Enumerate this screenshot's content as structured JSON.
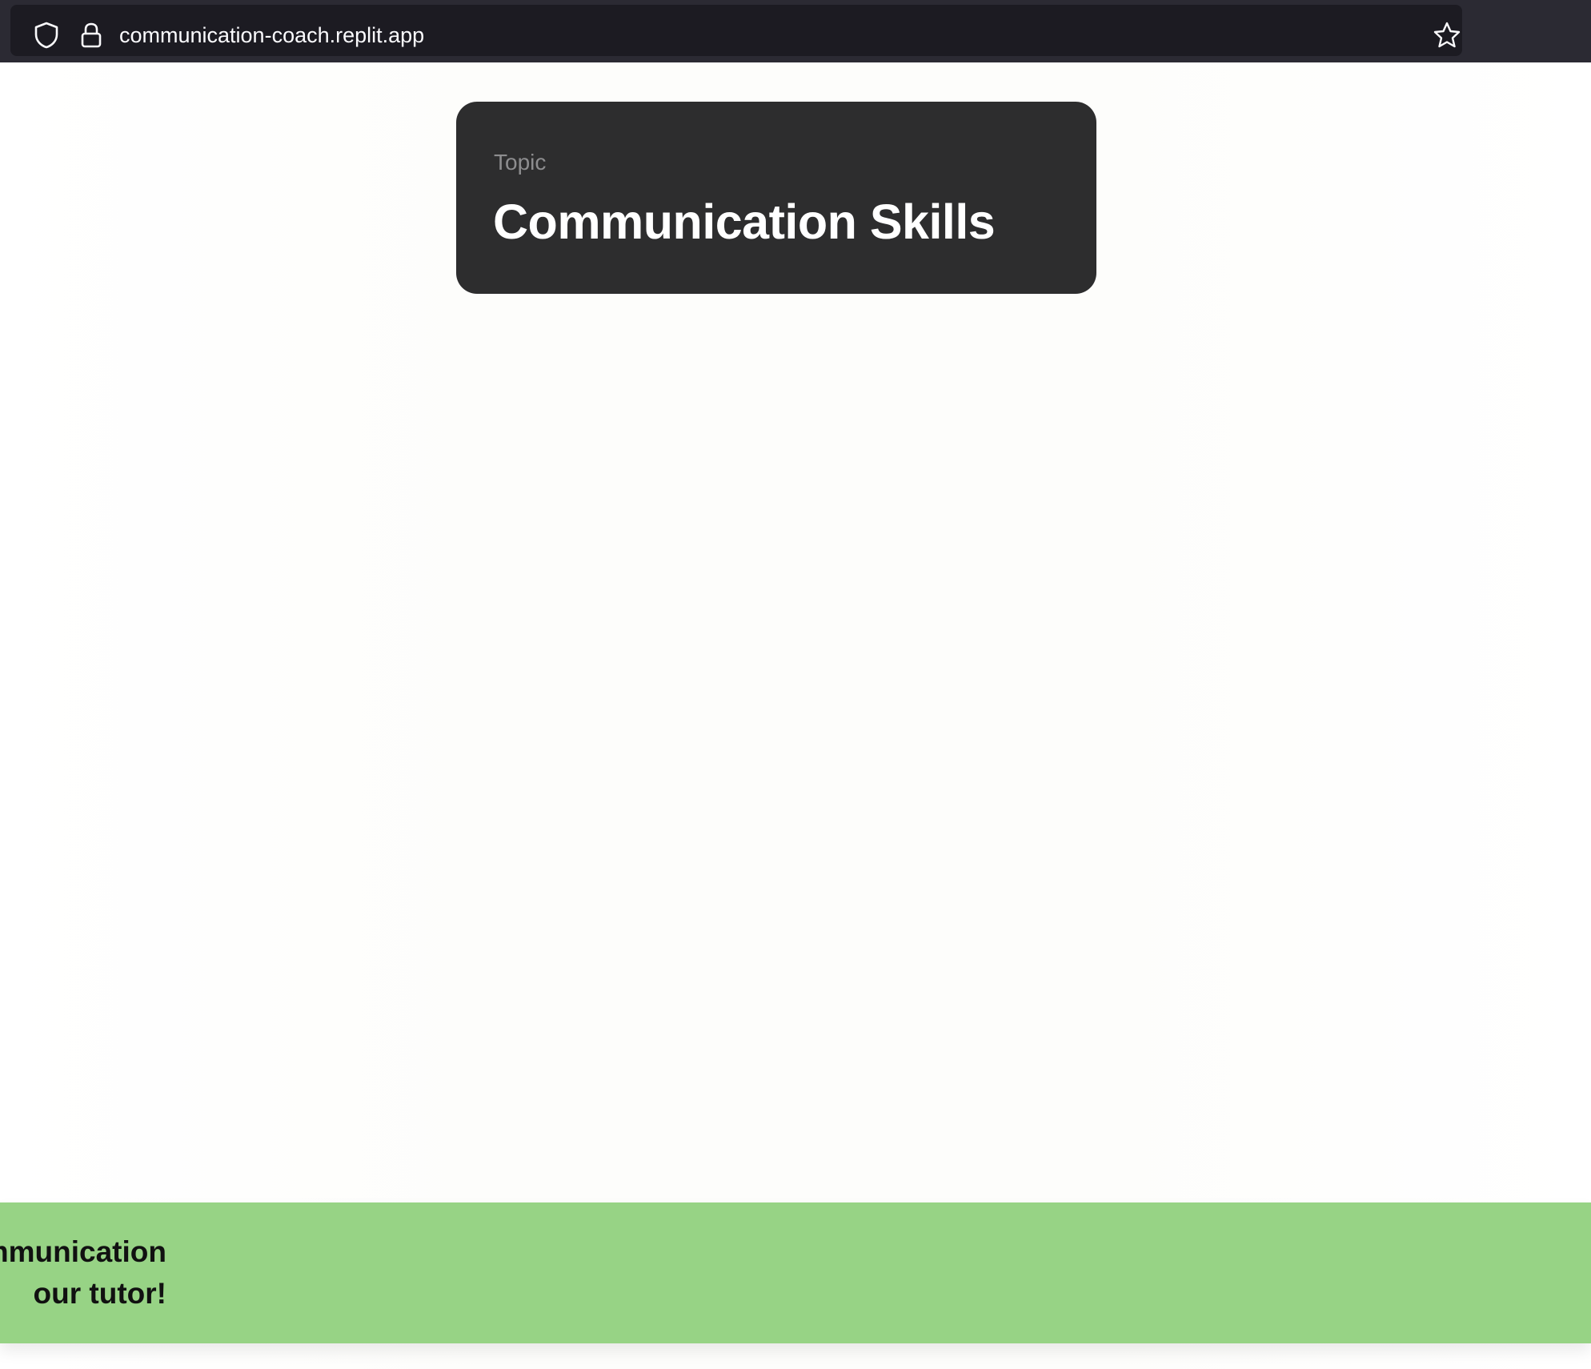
{
  "browser": {
    "url": "communication-coach.replit.app",
    "icons": [
      "shield-icon",
      "lock-icon",
      "star-icon"
    ]
  },
  "topic_card": {
    "label": "Topic",
    "title": "Communication Skills"
  },
  "banner": {
    "line1": "mmunication",
    "line2": "our tutor!",
    "color": "#97d385"
  }
}
